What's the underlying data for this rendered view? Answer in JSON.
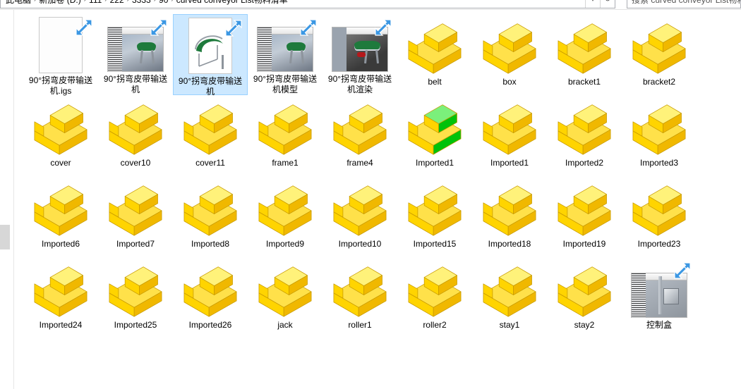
{
  "window": {
    "breadcrumb": [
      "此电脑",
      "新加卷 (D:)",
      "111",
      "222",
      "3333",
      "90",
      "curved conveyor List物料清单"
    ],
    "breadcrumb_separator": "›",
    "dropdown_icon": "chevron-down-icon",
    "refresh_icon": "refresh-icon",
    "search": {
      "placeholder": "搜索 curved conveyor List物料清单",
      "icon": "search-icon"
    }
  },
  "view": {
    "mode": "large-icons",
    "selection_color": "#cce8ff",
    "part_icon_color": "#ffd400",
    "part_icon_accent": "#00c20a"
  },
  "items": [
    {
      "label": "90°拐弯皮带输送机.igs",
      "icon": "document-thumbnail",
      "shortcut": true,
      "selected": false
    },
    {
      "label": "90°拐弯皮带输送机",
      "icon": "picture-thumbnail",
      "shortcut": true,
      "selected": false
    },
    {
      "label": "90°拐弯皮带输送机",
      "icon": "drawing-thumbnail",
      "shortcut": true,
      "selected": true
    },
    {
      "label": "90°拐弯皮带输送机模型",
      "icon": "picture-thumbnail",
      "shortcut": true,
      "selected": false
    },
    {
      "label": "90°拐弯皮带输送机渲染",
      "icon": "render-thumbnail",
      "shortcut": true,
      "selected": false
    },
    {
      "label": "belt",
      "icon": "solidworks-part-icon",
      "shortcut": false,
      "selected": false
    },
    {
      "label": "box",
      "icon": "solidworks-part-icon",
      "shortcut": false,
      "selected": false
    },
    {
      "label": "bracket1",
      "icon": "solidworks-part-icon",
      "shortcut": false,
      "selected": false
    },
    {
      "label": "bracket2",
      "icon": "solidworks-part-icon",
      "shortcut": false,
      "selected": false
    },
    {
      "label": "cover",
      "icon": "solidworks-part-icon",
      "shortcut": false,
      "selected": false
    },
    {
      "label": "cover10",
      "icon": "solidworks-part-icon",
      "shortcut": false,
      "selected": false
    },
    {
      "label": "cover11",
      "icon": "solidworks-part-icon",
      "shortcut": false,
      "selected": false
    },
    {
      "label": "frame1",
      "icon": "solidworks-part-icon",
      "shortcut": false,
      "selected": false
    },
    {
      "label": "frame4",
      "icon": "solidworks-part-icon",
      "shortcut": false,
      "selected": false
    },
    {
      "label": "Imported1",
      "icon": "solidworks-part-icon-green",
      "shortcut": false,
      "selected": false
    },
    {
      "label": "Imported1",
      "icon": "solidworks-part-icon",
      "shortcut": false,
      "selected": false
    },
    {
      "label": "Imported2",
      "icon": "solidworks-part-icon",
      "shortcut": false,
      "selected": false
    },
    {
      "label": "Imported3",
      "icon": "solidworks-part-icon",
      "shortcut": false,
      "selected": false
    },
    {
      "label": "Imported6",
      "icon": "solidworks-part-icon",
      "shortcut": false,
      "selected": false
    },
    {
      "label": "Imported7",
      "icon": "solidworks-part-icon",
      "shortcut": false,
      "selected": false
    },
    {
      "label": "Imported8",
      "icon": "solidworks-part-icon",
      "shortcut": false,
      "selected": false
    },
    {
      "label": "Imported9",
      "icon": "solidworks-part-icon",
      "shortcut": false,
      "selected": false
    },
    {
      "label": "Imported10",
      "icon": "solidworks-part-icon",
      "shortcut": false,
      "selected": false
    },
    {
      "label": "Imported15",
      "icon": "solidworks-part-icon",
      "shortcut": false,
      "selected": false
    },
    {
      "label": "Imported18",
      "icon": "solidworks-part-icon",
      "shortcut": false,
      "selected": false
    },
    {
      "label": "Imported19",
      "icon": "solidworks-part-icon",
      "shortcut": false,
      "selected": false
    },
    {
      "label": "Imported23",
      "icon": "solidworks-part-icon",
      "shortcut": false,
      "selected": false
    },
    {
      "label": "Imported24",
      "icon": "solidworks-part-icon",
      "shortcut": false,
      "selected": false
    },
    {
      "label": "Imported25",
      "icon": "solidworks-part-icon",
      "shortcut": false,
      "selected": false
    },
    {
      "label": "Imported26",
      "icon": "solidworks-part-icon",
      "shortcut": false,
      "selected": false
    },
    {
      "label": "jack",
      "icon": "solidworks-part-icon",
      "shortcut": false,
      "selected": false
    },
    {
      "label": "roller1",
      "icon": "solidworks-part-icon",
      "shortcut": false,
      "selected": false
    },
    {
      "label": "roller2",
      "icon": "solidworks-part-icon",
      "shortcut": false,
      "selected": false
    },
    {
      "label": "stay1",
      "icon": "solidworks-part-icon",
      "shortcut": false,
      "selected": false
    },
    {
      "label": "stay2",
      "icon": "solidworks-part-icon",
      "shortcut": false,
      "selected": false
    },
    {
      "label": "控制盒",
      "icon": "picture-thumbnail-control-box",
      "shortcut": true,
      "selected": false
    }
  ]
}
